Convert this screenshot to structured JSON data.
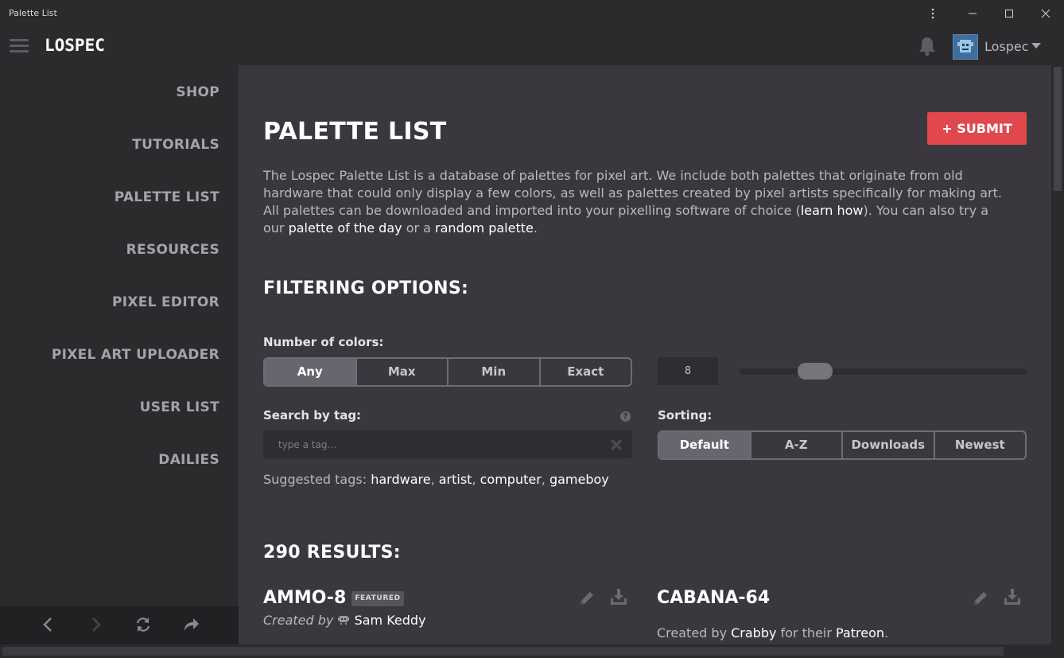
{
  "window": {
    "title": "Palette List"
  },
  "header": {
    "logo": "LOSPEC",
    "username": "Lospec"
  },
  "sidebar": {
    "items": [
      {
        "label": "SHOP"
      },
      {
        "label": "TUTORIALS"
      },
      {
        "label": "PALETTE LIST"
      },
      {
        "label": "RESOURCES"
      },
      {
        "label": "PIXEL EDITOR"
      },
      {
        "label": "PIXEL ART UPLOADER"
      },
      {
        "label": "USER LIST"
      },
      {
        "label": "DAILIES"
      }
    ]
  },
  "main": {
    "title": "PALETTE LIST",
    "submit_label": "+ SUBMIT",
    "intro": {
      "part1": "The Lospec Palette List is a database of palettes for pixel art. We include both palettes that originate from old hardware that could only display a few colors, as well as palettes created by pixel artists specifically for making art. All palettes can be downloaded and imported into your pixelling software of choice (",
      "learn_how": "learn how",
      "part2": "). You can also try a our ",
      "palette_of_the_day": "palette of the day",
      "part3": " or a ",
      "random_palette": "random palette",
      "part4": "."
    },
    "filtering": {
      "title": "FILTERING OPTIONS:",
      "num_colors_label": "Number of colors:",
      "num_colors_options": [
        "Any",
        "Max",
        "Min",
        "Exact"
      ],
      "num_colors_selected": "Any",
      "num_colors_value": "8",
      "slider_level": 0.23,
      "search_label": "Search by tag:",
      "search_placeholder": "type a tag...",
      "sorting_label": "Sorting:",
      "sorting_options": [
        "Default",
        "A-Z",
        "Downloads",
        "Newest"
      ],
      "sorting_selected": "Default",
      "suggested_label": "Suggested tags:",
      "suggested_tags": [
        "hardware",
        "artist",
        "computer",
        "gameboy"
      ]
    },
    "results": {
      "title": "290 RESULTS:",
      "palettes": [
        {
          "name": "AMMO-8",
          "badge": "FEATURED",
          "created_prefix": "Created by",
          "author": "Sam Keddy"
        },
        {
          "name": "CABANA-64",
          "created_prefix": "Created by",
          "author": "Crabby",
          "created_mid": "for their",
          "platform": "Patreon",
          "created_suffix": "."
        }
      ]
    }
  },
  "colors": {
    "accent": "#e0484d",
    "bg_main": "#3a383e",
    "bg_side": "#2b2a2d"
  }
}
